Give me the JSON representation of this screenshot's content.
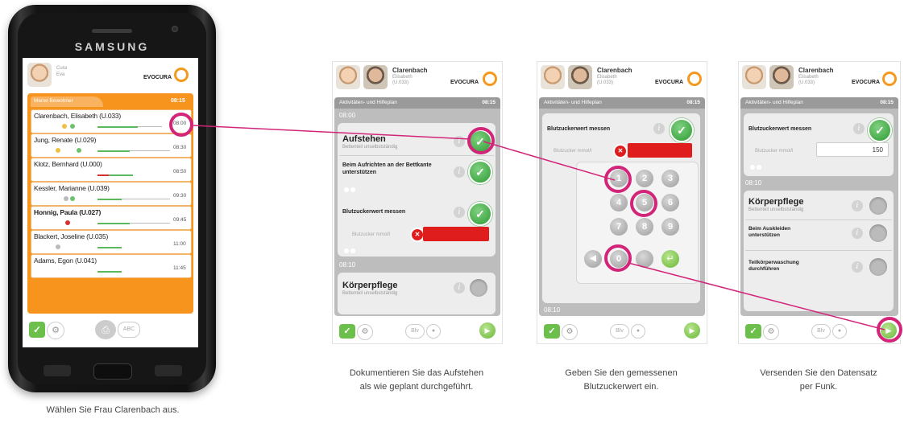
{
  "phone": {
    "brand": "SAMSUNG",
    "patient_first": "Cura",
    "patient_last": "Eva",
    "logo_text": "EVOCURA",
    "panel_title": "Meine Bewohner",
    "panel_time": "08:15",
    "rows": [
      {
        "name": "Clarenbach, Elisabeth (U.033)",
        "time": "08:00"
      },
      {
        "name": "Jung, Renate (U.029)",
        "time": "08:30"
      },
      {
        "name": "Klotz, Bernhard (U.000)",
        "time": "08:50"
      },
      {
        "name": "Kessler, Marianne (U.039)",
        "time": "09:30"
      },
      {
        "name": "Honnig, Paula (U.027)",
        "time": "09:45"
      },
      {
        "name": "Blackert, Joseline (U.035)",
        "time": "11:00"
      },
      {
        "name": "Adams, Egon (U.041)",
        "time": "11:45"
      }
    ],
    "footer_abc": "ABC"
  },
  "screens": {
    "header_name": "Clarenbach",
    "header_sub1": "Elisabeth",
    "header_sub2": "(U.033)",
    "logo_text": "EVOCURA",
    "bar_title": "Aktivitäten- und Hilfeplan",
    "bar_time": "08:15",
    "footer_btn": "Blv"
  },
  "screen1": {
    "group_time": "08:00",
    "items": [
      {
        "title": "Aufstehen",
        "sub": "Bettenteil unselbstständig"
      },
      {
        "title": "Beim Aufrichten an der Bettkante unterstützen",
        "sub": ""
      },
      {
        "title": "Blutzuckerwert messen",
        "sub": ""
      }
    ],
    "input_label": "Blutzucker mmol/l",
    "group_time2": "08:10",
    "next_title": "Körperpflege",
    "next_sub": "Bettenteil unselbstständig"
  },
  "screen2": {
    "item_title": "Blutzuckerwert messen",
    "input_label": "Blutzucker mmol/l",
    "keys": [
      "1",
      "2",
      "3",
      "4",
      "5",
      "6",
      "7",
      "8",
      "9",
      "0"
    ],
    "group_time2": "08:10"
  },
  "screen3": {
    "item_title": "Blutzuckerwert messen",
    "input_label": "Blutzucker mmol/l",
    "input_value": "150",
    "group_time2": "08:10",
    "next_title": "Körperpflege",
    "next_sub": "Bettenteil unselbstständig",
    "sub_items": [
      "Beim Auskleiden unterstützen",
      "Teilkörperwaschung durchführen"
    ]
  },
  "captions": {
    "phone": "Wählen Sie Frau Clarenbach aus.",
    "s1_line1": "Dokumentieren Sie das Aufstehen",
    "s1_line2": "als wie geplant durchgeführt.",
    "s2_line1": "Geben Sie den gemessenen",
    "s2_line2": "Blutzuckerwert ein.",
    "s3_line1": "Versenden Sie den Datensatz",
    "s3_line2": "per Funk."
  },
  "colors": {
    "accent_orange": "#f7941d",
    "highlight_pink": "#d2257a",
    "check_green": "#2e9a35",
    "error_red": "#e01d1d"
  }
}
